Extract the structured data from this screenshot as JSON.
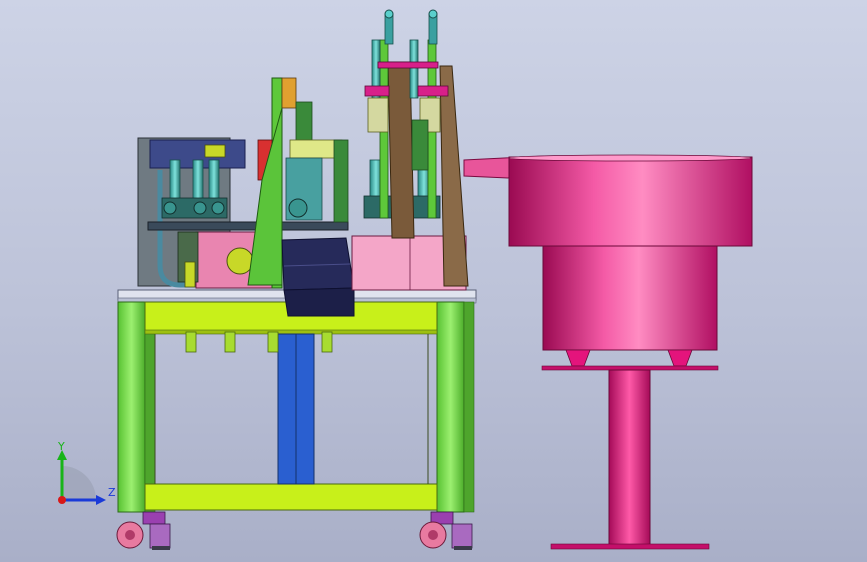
{
  "view": {
    "background_top": "#cdd3e6",
    "background_bottom": "#a9afc8"
  },
  "triad": {
    "x_label": "",
    "y_label": "Y",
    "z_label": "Z",
    "y_color": "#18b418",
    "z_color": "#1a3ad8",
    "x_color": "#d81818"
  },
  "colors": {
    "frame_green": "#7be04a",
    "frame_yellow": "#c8f01a",
    "blue_column": "#2a5fd0",
    "bowl_magenta": "#e4147c",
    "plate_gray": "#d9dde8",
    "bronze": "#7a5a3a",
    "cyan_parts": "#3fb5b0",
    "pink_block": "#f4a6c8",
    "navy_tray": "#262a5a",
    "caster_pink": "#e87aa0"
  }
}
